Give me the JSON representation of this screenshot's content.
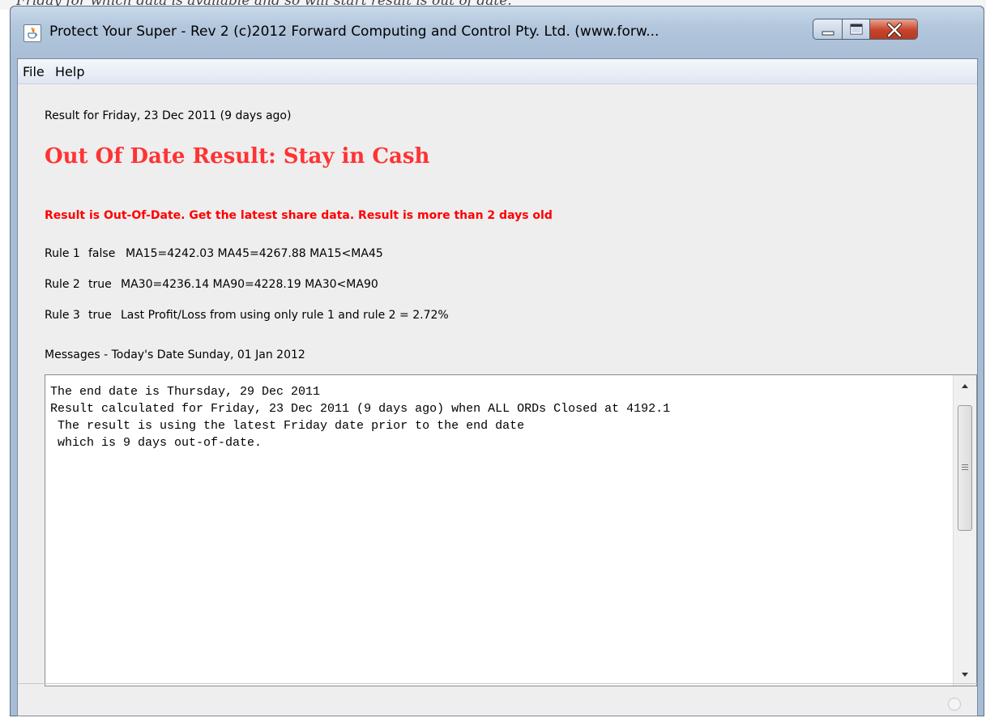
{
  "background_text": "Friday for which data is available and so will start result is out of date.",
  "window": {
    "title": "Protect Your Super - Rev 2 (c)2012 Forward Computing and Control Pty. Ltd. (www.forw...",
    "app_icon": "java-icon",
    "controls": {
      "minimize": "minimize-icon",
      "maximize": "maximize-icon",
      "close": "close-icon"
    }
  },
  "menu": {
    "items": [
      "File",
      "Help"
    ]
  },
  "result": {
    "result_for": "Result for Friday, 23 Dec 2011 (9 days ago)",
    "headline": "Out Of Date Result: Stay in Cash",
    "warning": "Result is Out-Of-Date. Get the latest share data. Result is more than 2 days old"
  },
  "rules": [
    {
      "name": "Rule 1",
      "value": "false",
      "detail": "MA15=4242.03 MA45=4267.88  MA15<MA45"
    },
    {
      "name": "Rule 2",
      "value": "true",
      "detail": "MA30=4236.14 MA90=4228.19  MA30<MA90"
    },
    {
      "name": "Rule 3",
      "value": "true",
      "detail": "Last Profit/Loss from using only rule 1 and rule 2  =  2.72%"
    }
  ],
  "messages": {
    "label": "Messages - Today's Date Sunday, 01 Jan 2012",
    "lines": [
      "The end date is Thursday, 29 Dec 2011",
      "Result calculated for Friday, 23 Dec 2011 (9 days ago) when ALL ORDs Closed at 4192.1",
      " The result is using the latest Friday date prior to the end date",
      " which is 9 days out-of-date."
    ]
  },
  "colors": {
    "headline": "#ff3333",
    "warning": "#ff0000",
    "titlebar": "#b2c6dc",
    "close_button": "#c8432a"
  }
}
